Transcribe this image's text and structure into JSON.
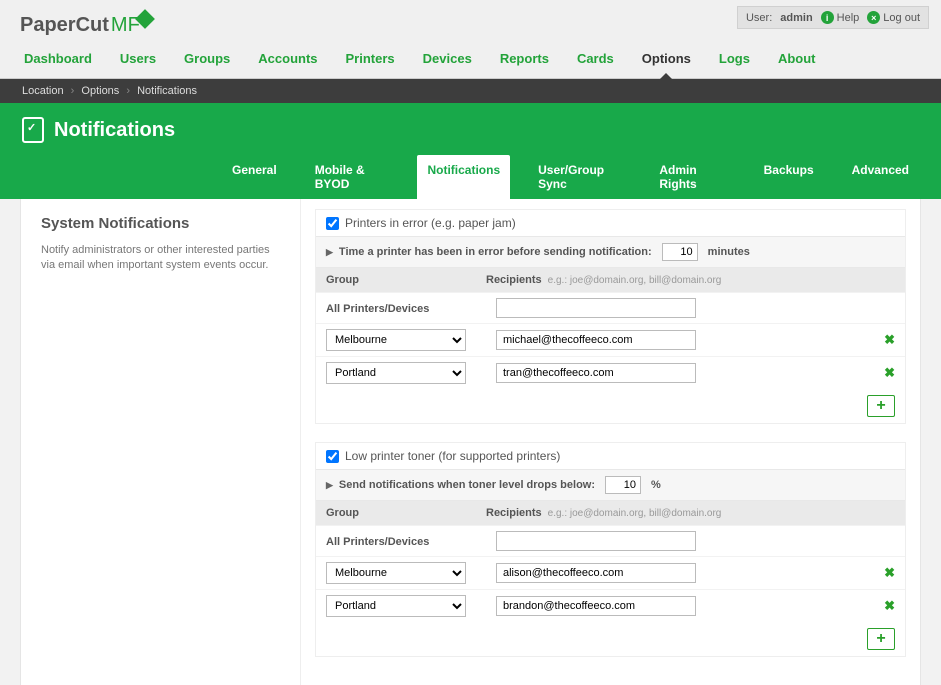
{
  "user": {
    "label": "User:",
    "name": "admin",
    "help": "Help",
    "logout": "Log out"
  },
  "nav": [
    "Dashboard",
    "Users",
    "Groups",
    "Accounts",
    "Printers",
    "Devices",
    "Reports",
    "Cards",
    "Options",
    "Logs",
    "About"
  ],
  "nav_active_index": 8,
  "breadcrumb": [
    "Location",
    "Options",
    "Notifications"
  ],
  "page_title": "Notifications",
  "subtabs": [
    "General",
    "Mobile & BYOD",
    "Notifications",
    "User/Group Sync",
    "Admin Rights",
    "Backups",
    "Advanced"
  ],
  "subtab_active_index": 2,
  "left": {
    "heading": "System Notifications",
    "desc": "Notify administrators or other interested parties via email when important system events occur."
  },
  "columns": {
    "group": "Group",
    "recip": "Recipients",
    "hint": "e.g.: joe@domain.org, bill@domain.org"
  },
  "all_printers_label": "All Printers/Devices",
  "sections": [
    {
      "checkbox_label": "Printers in error (e.g. paper jam)",
      "checked": true,
      "disclosure_pre": "Time a printer has been in error before sending notification:",
      "disclosure_value": "10",
      "disclosure_unit": "minutes",
      "all_value": "",
      "rows": [
        {
          "group": "Melbourne",
          "recip": "michael@thecoffeeco.com"
        },
        {
          "group": "Portland",
          "recip": "tran@thecoffeeco.com"
        }
      ]
    },
    {
      "checkbox_label": "Low printer toner (for supported printers)",
      "checked": true,
      "disclosure_pre": "Send notifications when toner level drops below:",
      "disclosure_value": "10",
      "disclosure_unit": "%",
      "all_value": "",
      "rows": [
        {
          "group": "Melbourne",
          "recip": "alison@thecoffeeco.com"
        },
        {
          "group": "Portland",
          "recip": "brandon@thecoffeeco.com"
        }
      ]
    }
  ]
}
